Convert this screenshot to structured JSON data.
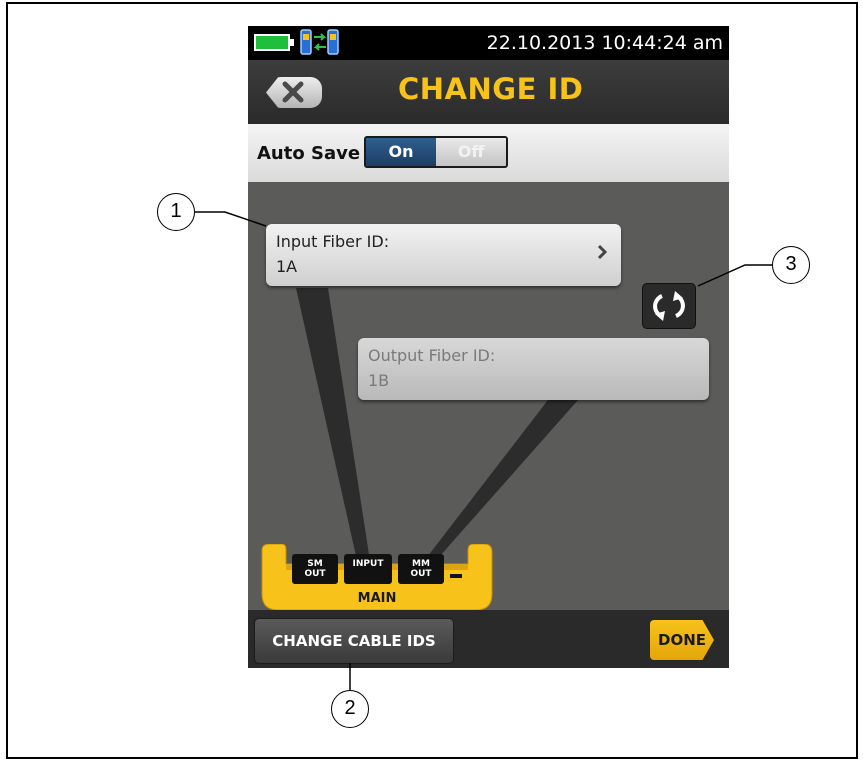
{
  "status_bar": {
    "datetime": "22.10.2013 10:44:24 am",
    "battery_color": "#1fbe3d"
  },
  "header": {
    "title": "CHANGE ID",
    "close_icon": "close-x-icon",
    "title_color": "#f7c21a"
  },
  "auto_save": {
    "label": "Auto Save",
    "on_label": "On",
    "off_label": "Off",
    "selected": "On"
  },
  "input_fiber": {
    "label": "Input Fiber ID:",
    "value": "1A"
  },
  "output_fiber": {
    "label": "Output Fiber ID:",
    "value": "1B"
  },
  "swap_icon": "swap-rotate-icon",
  "device_ports": {
    "sm_out": "SM OUT",
    "input": "INPUT",
    "mm_out": "MM OUT",
    "main": "MAIN"
  },
  "footer": {
    "change_cable_label": "CHANGE CABLE IDS",
    "done_label": "DONE",
    "done_color": "#f7c21a"
  },
  "callouts": [
    "1",
    "2",
    "3"
  ]
}
